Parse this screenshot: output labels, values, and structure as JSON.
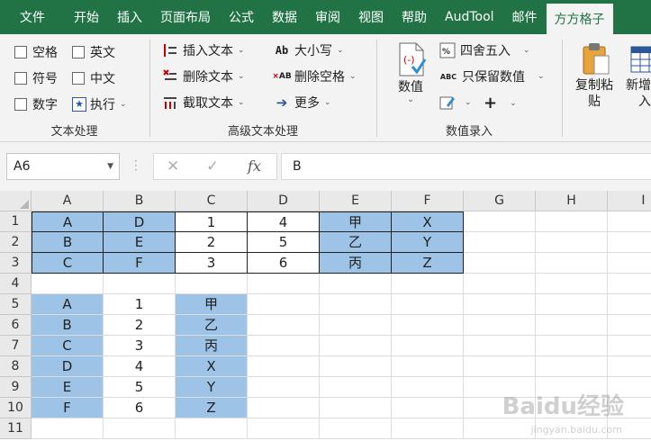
{
  "menu": [
    "文件",
    "开始",
    "插入",
    "页面布局",
    "公式",
    "数据",
    "审阅",
    "视图",
    "帮助",
    "AudTool",
    "邮件",
    "方方格子"
  ],
  "ribbon": {
    "text_group": {
      "label": "文本处理",
      "checkboxes": [
        "空格",
        "英文",
        "符号",
        "中文",
        "数字"
      ],
      "exec_label": "执行"
    },
    "adv_group": {
      "label": "高级文本处理",
      "insert_text": "插入文本",
      "delete_text": "删除文本",
      "cut_text": "截取文本",
      "case": "大小写",
      "delete_spaces": "删除空格",
      "more": "更多",
      "case_icon": "Ab",
      "delete_spaces_icon": "AB"
    },
    "num_group": {
      "label": "数值录入",
      "value_btn": "数值",
      "round": "四舍五入",
      "keep_value": "只保留数值",
      "keep_value_icon": "ABC",
      "plus": "+"
    },
    "copy_paste": "复制粘",
    "copy_paste2": "贴",
    "new_insert": "新增插",
    "new_insert2": "入"
  },
  "formula_bar": {
    "name_box": "A6",
    "value": "B",
    "fx": "fx"
  },
  "columns": [
    "A",
    "B",
    "C",
    "D",
    "E",
    "F",
    "G",
    "H",
    "I"
  ],
  "rows": [
    "1",
    "2",
    "3",
    "4",
    "5",
    "6",
    "7",
    "8",
    "9",
    "10",
    "11"
  ],
  "table1": [
    [
      "A",
      "D",
      "1",
      "4",
      "甲",
      "X"
    ],
    [
      "B",
      "E",
      "2",
      "5",
      "乙",
      "Y"
    ],
    [
      "C",
      "F",
      "3",
      "6",
      "丙",
      "Z"
    ]
  ],
  "table2": [
    [
      "A",
      "1",
      "甲"
    ],
    [
      "B",
      "2",
      "乙"
    ],
    [
      "C",
      "3",
      "丙"
    ],
    [
      "D",
      "4",
      "X"
    ],
    [
      "E",
      "5",
      "Y"
    ],
    [
      "F",
      "6",
      "Z"
    ]
  ],
  "colors": {
    "title_bar": "#217346",
    "cell_fill": "#9dc3e6",
    "ribbon_bg": "#f3f3f3"
  },
  "watermark": "Baidu经验",
  "watermark_sub": "jingyan.baidu.com"
}
